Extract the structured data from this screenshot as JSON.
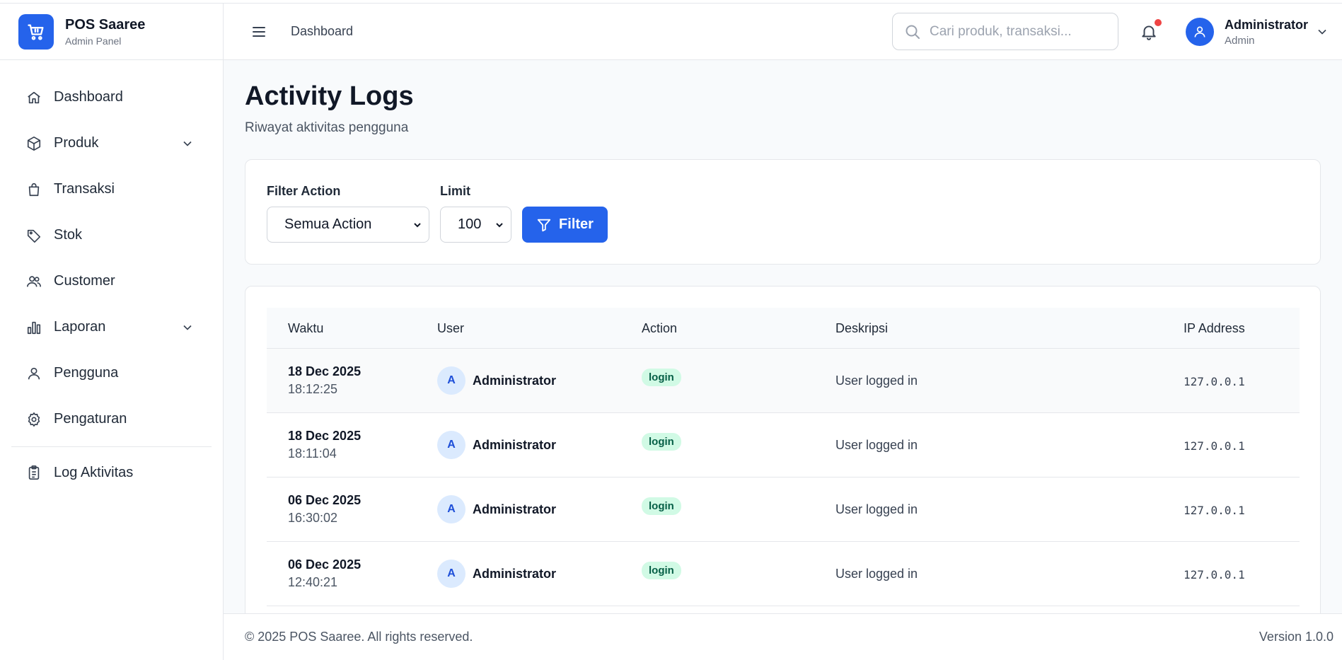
{
  "brand": {
    "name": "POS Saaree",
    "subtitle": "Admin Panel"
  },
  "sidebar": {
    "items": [
      {
        "label": "Dashboard",
        "icon": "home-icon",
        "has_submenu": false
      },
      {
        "label": "Produk",
        "icon": "box-icon",
        "has_submenu": true
      },
      {
        "label": "Transaksi",
        "icon": "shopping-bag-icon",
        "has_submenu": false
      },
      {
        "label": "Stok",
        "icon": "tag-icon",
        "has_submenu": false
      },
      {
        "label": "Customer",
        "icon": "users-icon",
        "has_submenu": false
      },
      {
        "label": "Laporan",
        "icon": "bar-chart-icon",
        "has_submenu": true
      },
      {
        "label": "Pengguna",
        "icon": "user-icon",
        "has_submenu": false
      },
      {
        "label": "Pengaturan",
        "icon": "gear-icon",
        "has_submenu": false
      }
    ],
    "extra_item": {
      "label": "Log Aktivitas",
      "icon": "clipboard-list-icon"
    }
  },
  "header": {
    "breadcrumb": "Dashboard",
    "search_placeholder": "Cari produk, transaksi...",
    "has_notification": true,
    "user": {
      "name": "Administrator",
      "role": "Admin"
    }
  },
  "page": {
    "title": "Activity Logs",
    "subtitle": "Riwayat aktivitas pengguna"
  },
  "filters": {
    "action_label": "Filter Action",
    "action_value": "Semua Action",
    "limit_label": "Limit",
    "limit_value": "100",
    "button_label": "Filter"
  },
  "table": {
    "columns": [
      "Waktu",
      "User",
      "Action",
      "Deskripsi",
      "IP Address"
    ],
    "rows": [
      {
        "date": "18 Dec 2025",
        "time": "18:12:25",
        "avatar": "A",
        "user": "Administrator",
        "action": "login",
        "description": "User logged in",
        "ip": "127.0.0.1"
      },
      {
        "date": "18 Dec 2025",
        "time": "18:11:04",
        "avatar": "A",
        "user": "Administrator",
        "action": "login",
        "description": "User logged in",
        "ip": "127.0.0.1"
      },
      {
        "date": "06 Dec 2025",
        "time": "16:30:02",
        "avatar": "A",
        "user": "Administrator",
        "action": "login",
        "description": "User logged in",
        "ip": "127.0.0.1"
      },
      {
        "date": "06 Dec 2025",
        "time": "12:40:21",
        "avatar": "A",
        "user": "Administrator",
        "action": "login",
        "description": "User logged in",
        "ip": "127.0.0.1"
      }
    ]
  },
  "footer": {
    "copyright": "© 2025 POS Saaree. All rights reserved.",
    "version": "Version 1.0.0"
  },
  "colors": {
    "primary": "#2563eb",
    "badge_bg": "#d1fae5",
    "badge_text": "#065f46",
    "notification": "#ef4444",
    "page_bg": "#f8fafc"
  }
}
